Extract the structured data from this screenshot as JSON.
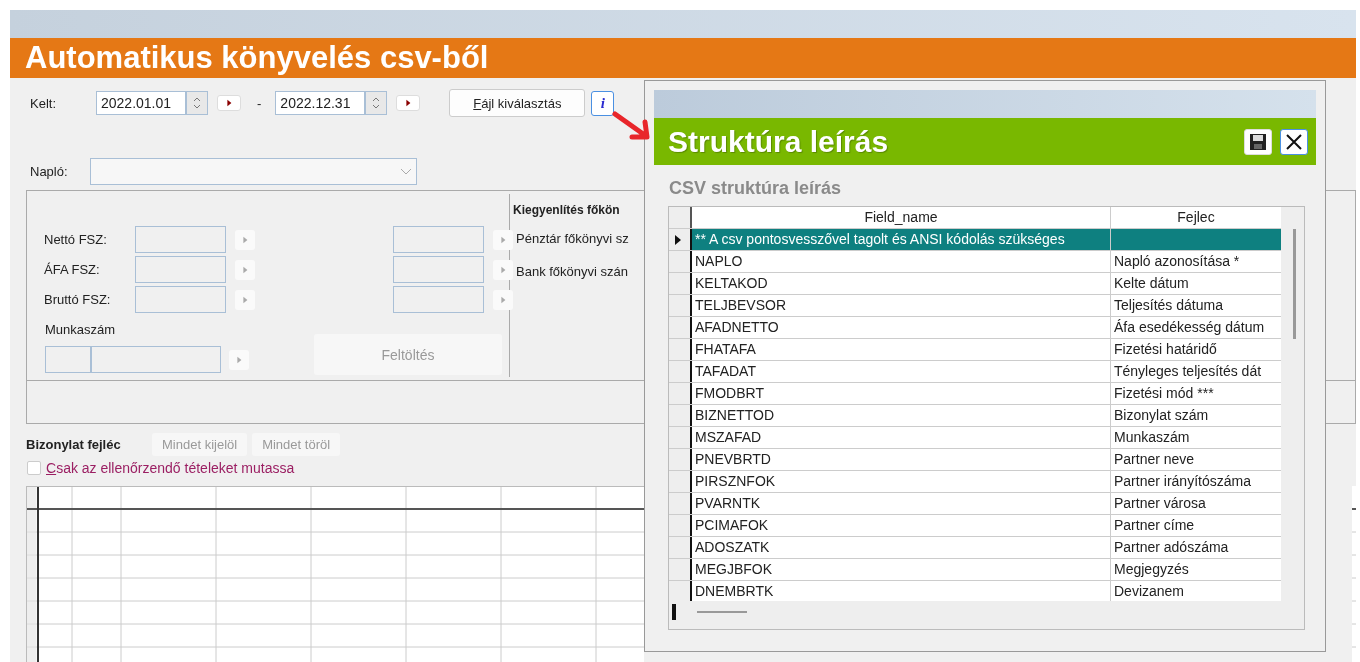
{
  "window": {
    "title": "Automatikus könyvelés csv-ből"
  },
  "date_range": {
    "label": "Kelt:",
    "from": "2022.01.01",
    "separator": "-",
    "to": "2022.12.31"
  },
  "file_button": {
    "label": "Fájl kiválasztás"
  },
  "info_button": {
    "label": "i"
  },
  "naplo": {
    "label": "Napló:"
  },
  "accounts": [
    {
      "label": "Nettó FSZ:"
    },
    {
      "label": "ÁFA FSZ:"
    },
    {
      "label": "Bruttó FSZ:"
    }
  ],
  "munkaszam": {
    "label": "Munkaszám"
  },
  "fill_button": {
    "label": "Feltöltés",
    "disabled": true
  },
  "settlement": {
    "title": "Kiegyenlítés főkön",
    "rows": [
      "Pénztár főkönyvi sz",
      "Bank főkönyvi szán"
    ]
  },
  "document_header": {
    "title": "Bizonylat fejléc",
    "buttons": [
      {
        "label": "Mindet kijelöl",
        "disabled": true
      },
      {
        "label": "Mindet töröl",
        "disabled": true
      }
    ]
  },
  "filter_checkbox": {
    "label": "Csak az ellenőrzendő tételeket mutassa",
    "checked": false
  },
  "dialog": {
    "title": "Struktúra leírás",
    "subtitle": "CSV struktúra leírás",
    "columns": [
      "Field_name",
      "Fejlec"
    ],
    "rows": [
      {
        "field_name": "** A csv pontosvesszővel tagolt és  ANSI kódolás szükséges",
        "selected": true
      },
      {
        "field_name": "NAPLO",
        "fejlec": "Napló azonosítása *",
        "selected": false
      },
      {
        "field_name": "KELTAKOD",
        "fejlec": "Kelte dátum",
        "selected": false
      },
      {
        "field_name": "TELJBEVSOR",
        "fejlec": "Teljesítés dátuma",
        "selected": false
      },
      {
        "field_name": "AFADNETTO",
        "fejlec": "Áfa esedékesség dátum",
        "selected": false
      },
      {
        "field_name": "FHATAFA",
        "fejlec": "Fizetési határidő",
        "selected": false
      },
      {
        "field_name": "TAFADAT",
        "fejlec": "Tényleges teljesítés dát",
        "selected": false
      },
      {
        "field_name": "FMODBRT",
        "fejlec": "Fizetési mód ***",
        "selected": false
      },
      {
        "field_name": "BIZNETTOD",
        "fejlec": "Bizonylat szám",
        "selected": false
      },
      {
        "field_name": "MSZAFAD",
        "fejlec": "Munkaszám",
        "selected": false
      },
      {
        "field_name": "PNEVBRTD",
        "fejlec": "Partner neve",
        "selected": false
      },
      {
        "field_name": "PIRSZNFOK",
        "fejlec": "Partner irányítószáma",
        "selected": false
      },
      {
        "field_name": "PVARNTK",
        "fejlec": "Partner városa",
        "selected": false
      },
      {
        "field_name": "PCIMAFOK",
        "fejlec": "Partner címe",
        "selected": false
      },
      {
        "field_name": "ADOSZATK",
        "fejlec": "Partner adószáma",
        "selected": false
      },
      {
        "field_name": "MEGJBFOK",
        "fejlec": "Megjegyzés",
        "selected": false
      },
      {
        "field_name": "DNEMBRTK",
        "fejlec": "Devizanem",
        "selected": false
      }
    ]
  }
}
